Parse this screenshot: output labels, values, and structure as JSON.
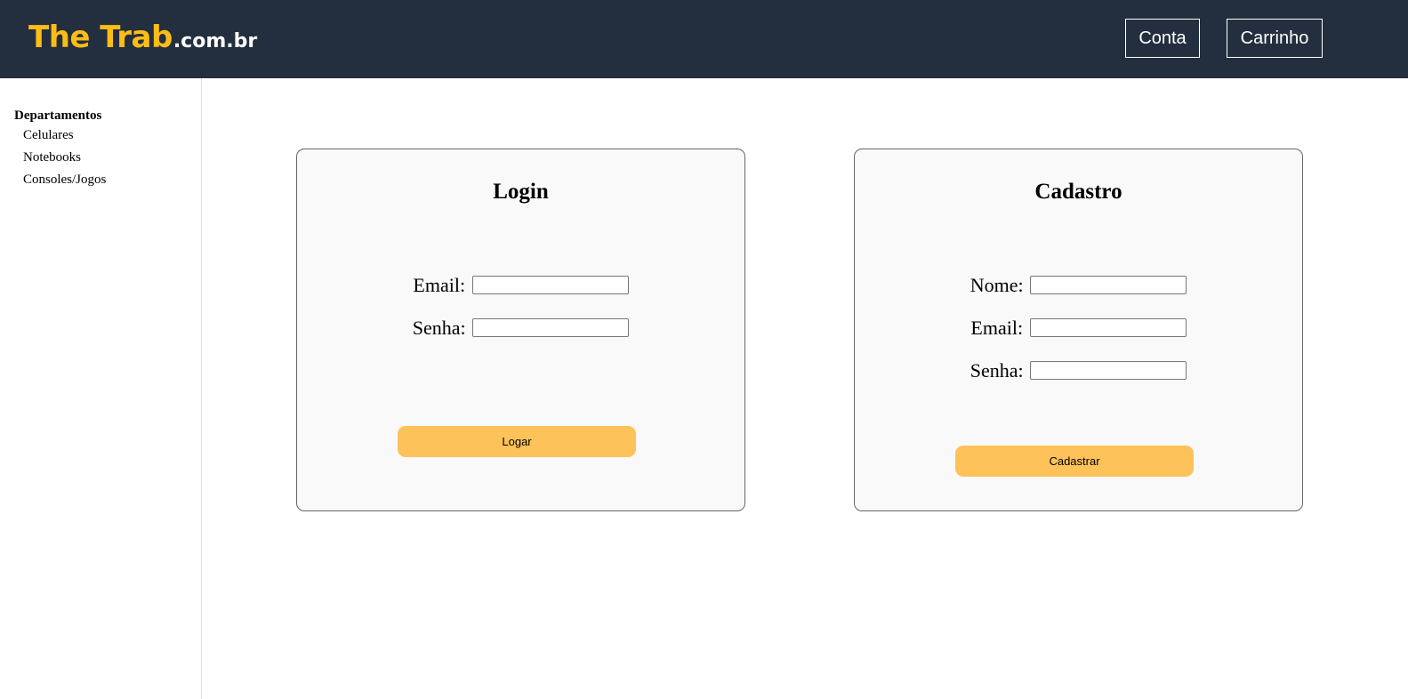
{
  "header": {
    "logo_main": "The Trab",
    "logo_tld": ".com.br",
    "nav": {
      "conta_label": "Conta",
      "carrinho_label": "Carrinho"
    }
  },
  "sidebar": {
    "title": "Departamentos",
    "items": [
      {
        "label": "Celulares"
      },
      {
        "label": "Notebooks"
      },
      {
        "label": "Consoles/Jogos"
      }
    ]
  },
  "login": {
    "title": "Login",
    "email_label": "Email:",
    "email_value": "",
    "senha_label": "Senha:",
    "senha_value": "",
    "button_label": "Logar"
  },
  "cadastro": {
    "title": "Cadastro",
    "nome_label": "Nome:",
    "nome_value": "",
    "email_label": "Email:",
    "email_value": "",
    "senha_label": "Senha:",
    "senha_value": "",
    "button_label": "Cadastrar"
  },
  "colors": {
    "header_bg": "#232f3e",
    "logo_accent": "#febd16",
    "button_accent": "#fec25a",
    "panel_bg": "#f9f9f9"
  }
}
